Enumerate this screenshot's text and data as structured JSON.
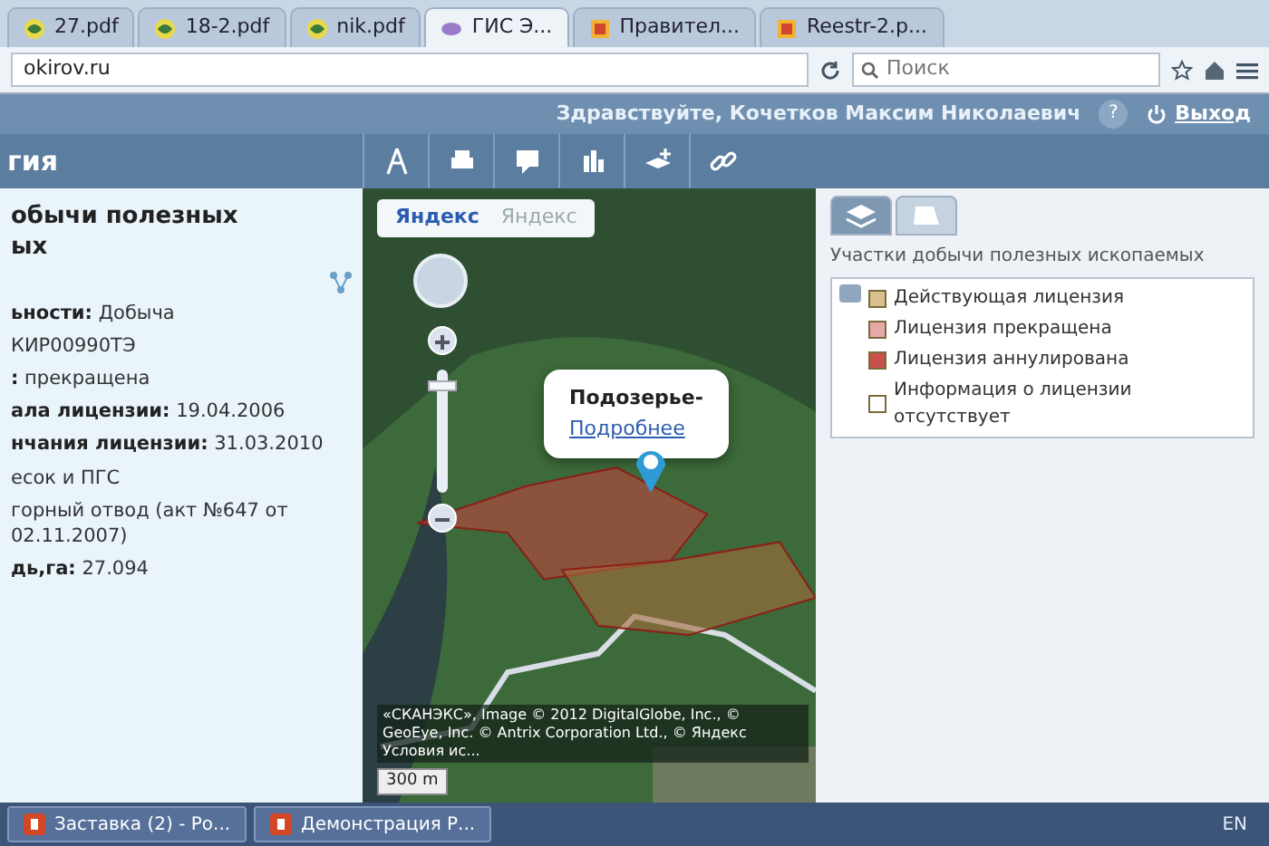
{
  "browser": {
    "tabs": [
      {
        "label": "27.pdf",
        "kind": "pdf",
        "selected": false
      },
      {
        "label": "18-2.pdf",
        "kind": "pdf",
        "selected": false
      },
      {
        "label": "nik.pdf",
        "kind": "pdf",
        "selected": false
      },
      {
        "label": "ГИС Э...",
        "kind": "web",
        "selected": true
      },
      {
        "label": "Правител...",
        "kind": "doc",
        "selected": false
      },
      {
        "label": "Reestr-2.p...",
        "kind": "doc",
        "selected": false
      }
    ],
    "address": "okirov.ru",
    "search": {
      "placeholder": "Поиск"
    }
  },
  "header": {
    "greeting": "Здравствуйте, Кочетков Максим Николаевич",
    "help": "?",
    "logout": "Выход"
  },
  "toolbar": {
    "title": "гия"
  },
  "info_panel": {
    "title_lines": [
      "обычи полезных",
      "ых"
    ],
    "fields": [
      {
        "label": "ьности:",
        "value": "Добыча"
      },
      {
        "value": "КИР00990ТЭ"
      },
      {
        "label": ":",
        "value": "прекращена"
      },
      {
        "label": "ала лицензии:",
        "value": "19.04.2006"
      },
      {
        "label": "нчания лицензии:",
        "value": "31.03.2010"
      },
      {
        "value": "есок и ПГС"
      },
      {
        "value": "горный отвод (акт №647 от 02.11.2007)"
      },
      {
        "label": "дь,га:",
        "value": "27.094"
      }
    ]
  },
  "map": {
    "layers": [
      {
        "label": "Яндекс",
        "selected": true
      },
      {
        "label": "Яндекс",
        "selected": false
      }
    ],
    "popup": {
      "title": "Подозерье-",
      "link": "Подробнее"
    },
    "scale": "300 m",
    "copyright": "«СКАНЭКС», Image © 2012 DigitalGlobe, Inc., © GeoEye, Inc. © Antrix Corporation Ltd., © Яндекс Условия ис..."
  },
  "layers_panel": {
    "tabs": [
      {
        "kind": "layers",
        "selected": true
      },
      {
        "kind": "base",
        "selected": false
      }
    ],
    "group": "Участки добычи полезных ископаемых",
    "legend": [
      {
        "label": "Действующая лицензия",
        "color": "#d8c08e"
      },
      {
        "label": "Лицензия прекращена",
        "color": "#e9a8a8"
      },
      {
        "label": "Лицензия аннулирована",
        "color": "#c9504b"
      },
      {
        "label": "Информация о лицензии отсутствует",
        "color": "#ffffff"
      }
    ]
  },
  "taskbar": {
    "items": [
      {
        "label": "Заставка (2) - Ро...",
        "selected": false
      },
      {
        "label": "Демонстрация Р...",
        "selected": false
      }
    ],
    "language": "EN"
  }
}
